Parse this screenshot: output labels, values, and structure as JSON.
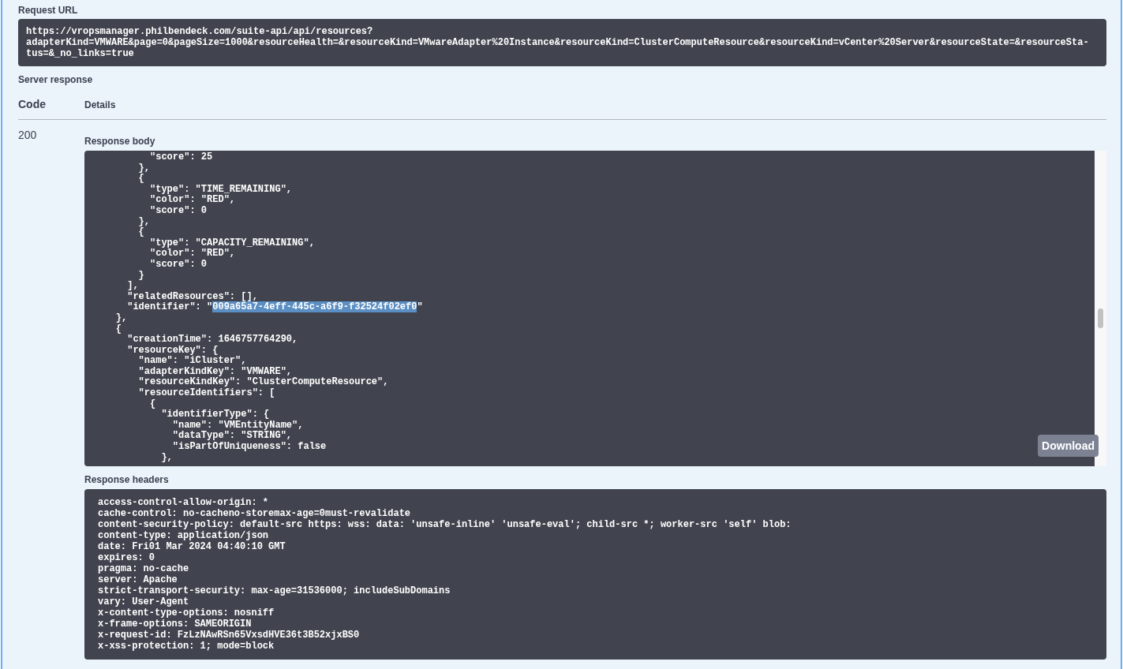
{
  "request_url": {
    "label": "Request URL",
    "lines": [
      "https://vropsmanager.philbendeck.com/suite-api/api/resources?",
      "adapterKind=VMWARE&page=0&pageSize=1000&resourceHealth=&resourceKind=VMwareAdapter%20Instance&resourceKind=ClusterComputeResource&resourceKind=vCenter%20Server&resourceState=&resourceSta-",
      "tus=&_no_links=true"
    ]
  },
  "server_response": {
    "label": "Server response",
    "columns": [
      "Code",
      "Details"
    ],
    "code": "200",
    "response_body": {
      "label": "Response body",
      "download_button": "Download",
      "lines": [
        {
          "parts": [
            {
              "text": "          \"score\": 25",
              "highlighted": false
            }
          ]
        },
        {
          "parts": [
            {
              "text": "        },",
              "highlighted": false
            }
          ]
        },
        {
          "parts": [
            {
              "text": "        {",
              "highlighted": false
            }
          ]
        },
        {
          "parts": [
            {
              "text": "          \"type\": \"TIME_REMAINING\",",
              "highlighted": false
            }
          ]
        },
        {
          "parts": [
            {
              "text": "          \"color\": \"RED\",",
              "highlighted": false
            }
          ]
        },
        {
          "parts": [
            {
              "text": "          \"score\": 0",
              "highlighted": false
            }
          ]
        },
        {
          "parts": [
            {
              "text": "        },",
              "highlighted": false
            }
          ]
        },
        {
          "parts": [
            {
              "text": "        {",
              "highlighted": false
            }
          ]
        },
        {
          "parts": [
            {
              "text": "          \"type\": \"CAPACITY_REMAINING\",",
              "highlighted": false
            }
          ]
        },
        {
          "parts": [
            {
              "text": "          \"color\": \"RED\",",
              "highlighted": false
            }
          ]
        },
        {
          "parts": [
            {
              "text": "          \"score\": 0",
              "highlighted": false
            }
          ]
        },
        {
          "parts": [
            {
              "text": "        }",
              "highlighted": false
            }
          ]
        },
        {
          "parts": [
            {
              "text": "      ],",
              "highlighted": false
            }
          ]
        },
        {
          "parts": [
            {
              "text": "      \"relatedResources\": [],",
              "highlighted": false
            }
          ]
        },
        {
          "parts": [
            {
              "text": "      \"identifier\": \"",
              "highlighted": false
            },
            {
              "text": "009a65a7-4eff-445c-a6f9-f32524f02ef0",
              "highlighted": true
            },
            {
              "text": "\"",
              "highlighted": false
            }
          ]
        },
        {
          "parts": [
            {
              "text": "    },",
              "highlighted": false
            }
          ]
        },
        {
          "parts": [
            {
              "text": "    {",
              "highlighted": false
            }
          ]
        },
        {
          "parts": [
            {
              "text": "      \"creationTime\": 1646757764290,",
              "highlighted": false
            }
          ]
        },
        {
          "parts": [
            {
              "text": "      \"resourceKey\": {",
              "highlighted": false
            }
          ]
        },
        {
          "parts": [
            {
              "text": "        \"name\": \"iCluster\",",
              "highlighted": false
            }
          ]
        },
        {
          "parts": [
            {
              "text": "        \"adapterKindKey\": \"VMWARE\",",
              "highlighted": false
            }
          ]
        },
        {
          "parts": [
            {
              "text": "        \"resourceKindKey\": \"ClusterComputeResource\",",
              "highlighted": false
            }
          ]
        },
        {
          "parts": [
            {
              "text": "        \"resourceIdentifiers\": [",
              "highlighted": false
            }
          ]
        },
        {
          "parts": [
            {
              "text": "          {",
              "highlighted": false
            }
          ]
        },
        {
          "parts": [
            {
              "text": "            \"identifierType\": {",
              "highlighted": false
            }
          ]
        },
        {
          "parts": [
            {
              "text": "              \"name\": \"VMEntityName\",",
              "highlighted": false
            }
          ]
        },
        {
          "parts": [
            {
              "text": "              \"dataType\": \"STRING\",",
              "highlighted": false
            }
          ]
        },
        {
          "parts": [
            {
              "text": "              \"isPartOfUniqueness\": false",
              "highlighted": false
            }
          ]
        },
        {
          "parts": [
            {
              "text": "            },",
              "highlighted": false
            }
          ]
        }
      ]
    },
    "response_headers": {
      "label": "Response headers",
      "lines": [
        "access-control-allow-origin: *",
        "cache-control: no-cacheno-storemax-age=0must-revalidate",
        "content-security-policy: default-src https: wss: data: 'unsafe-inline' 'unsafe-eval'; child-src *; worker-src 'self' blob:",
        "content-type: application/json",
        "date: Fri01 Mar 2024 04:40:10 GMT",
        "expires: 0",
        "pragma: no-cache",
        "server: Apache",
        "strict-transport-security: max-age=31536000; includeSubDomains",
        "vary: User-Agent",
        "x-content-type-options: nosniff",
        "x-frame-options: SAMEORIGIN",
        "x-request-id: FzLzNAwRSn65VxsdHVE36t3B52xjxBS0",
        "x-xss-protection: 1; mode=block"
      ]
    }
  }
}
